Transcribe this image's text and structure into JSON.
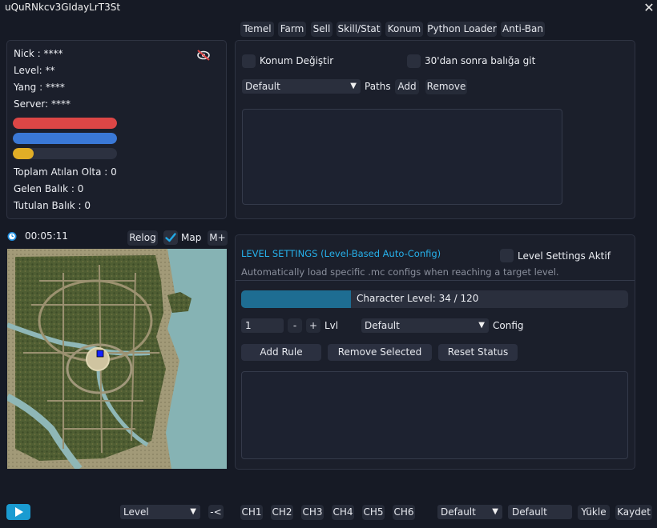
{
  "window": {
    "title": "uQuRNkcv3GIdayLrT3St",
    "close_glyph": "✕"
  },
  "tabs": [
    "Temel",
    "Farm",
    "Sell",
    "Skill/Stat",
    "Konum",
    "Python Loader",
    "Anti-Ban"
  ],
  "stats": {
    "nick": "Nick : ****",
    "level": "Level: **",
    "yang": "Yang : ****",
    "server": "Server: ****",
    "bars": [
      {
        "name": "hp",
        "color": "#dc4646",
        "fill": 1.0
      },
      {
        "name": "mp",
        "color": "#3a78d6",
        "fill": 1.0
      },
      {
        "name": "exp",
        "color": "#e2ae26",
        "fill": 0.2
      }
    ],
    "toplam": "Toplam Atılan Olta : 0",
    "gelen": "Gelen Balık : 0",
    "tutulan": "Tutulan Balık : 0"
  },
  "konum": {
    "change_label": "Konum Değiştir",
    "after30_label": "30'dan sonra balığa git",
    "path_select": "Default",
    "paths_label": "Paths",
    "add_label": "Add",
    "remove_label": "Remove"
  },
  "timer": {
    "value": "00:05:11",
    "relog": "Relog",
    "map_label": "Map",
    "map_checked": true,
    "mplus": "M+"
  },
  "level_settings": {
    "title": "LEVEL SETTINGS (Level-Based Auto-Config)",
    "enable_label": "Level Settings Aktif",
    "description": "Automatically load specific .mc configs when reaching a target level.",
    "progress_text": "Character Level: 34 / 120",
    "progress_current": 34,
    "progress_max": 120,
    "level_value": "1",
    "minus": "-",
    "plus": "+",
    "lvl_label": "Lvl",
    "config_select": "Default",
    "config_label": "Config",
    "add_rule": "Add Rule",
    "remove_selected": "Remove Selected",
    "reset_status": "Reset Status"
  },
  "bottom": {
    "mode_select": "Level",
    "back": "-<",
    "channels": [
      "CH1",
      "CH2",
      "CH3",
      "CH4",
      "CH5",
      "CH6"
    ],
    "profile_select": "Default",
    "profile_name": "Default",
    "load": "Yükle",
    "save": "Kaydet"
  },
  "colors": {
    "accent": "#1fa8e0",
    "progress": "#1e6d92",
    "play": "#1a9bd1"
  }
}
